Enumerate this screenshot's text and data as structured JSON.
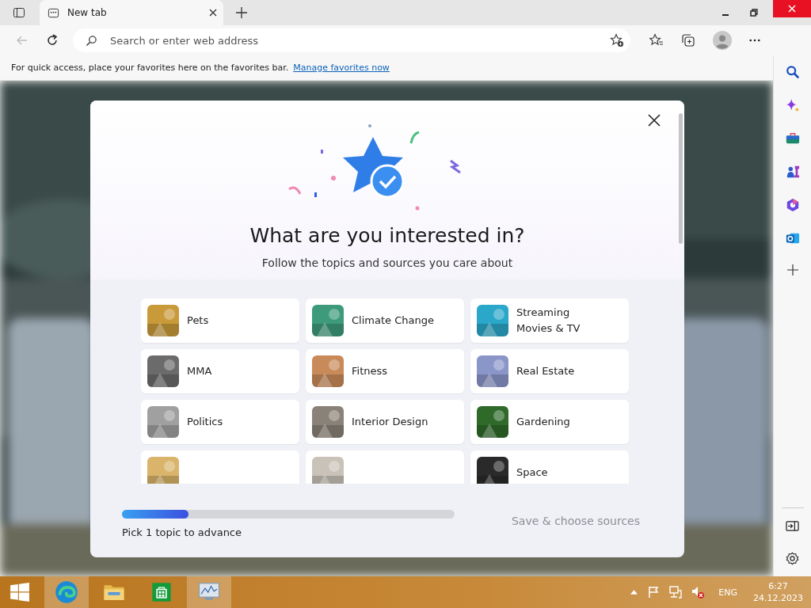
{
  "tabs": [
    {
      "title": "New tab",
      "selected": true
    }
  ],
  "address_bar": {
    "placeholder": "Search or enter web address"
  },
  "favorites_bar": {
    "message": "For quick access, place your favorites here on the favorites bar.",
    "link": "Manage favorites now"
  },
  "dialog": {
    "title": "What are you interested in?",
    "subtitle": "Follow the topics and sources you care about",
    "topics": [
      {
        "label": "Pets",
        "color": "#c99a3a"
      },
      {
        "label": "Climate Change",
        "color": "#3d9a7a"
      },
      {
        "label": "Streaming Movies & TV",
        "color": "#2aa7c9"
      },
      {
        "label": "MMA",
        "color": "#6b6b6b"
      },
      {
        "label": "Fitness",
        "color": "#c98a5a"
      },
      {
        "label": "Real Estate",
        "color": "#8a95c8"
      },
      {
        "label": "Politics",
        "color": "#a0a0a0"
      },
      {
        "label": "Interior Design",
        "color": "#8a8278"
      },
      {
        "label": "Gardening",
        "color": "#2f6a2a"
      },
      {
        "color": "#d9b46a"
      },
      {
        "color": "#c9c2b8"
      },
      {
        "label": "Space",
        "color": "#2a2a2a"
      }
    ],
    "progress": {
      "level": 0.2,
      "caption": "Pick 1 topic to advance"
    },
    "save_button": {
      "label": "Save & choose sources",
      "disabled": true
    }
  },
  "taskbar": {
    "language": "ENG",
    "time": "6:27",
    "date": "24.12.2023"
  }
}
